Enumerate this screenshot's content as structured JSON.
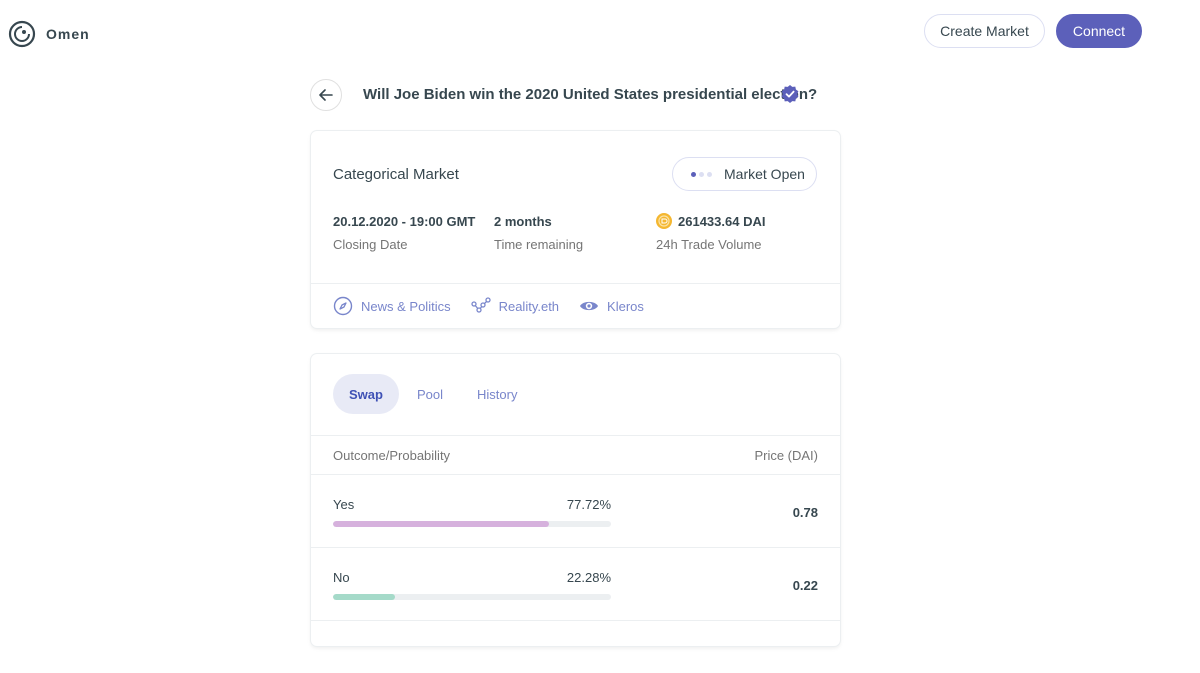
{
  "header": {
    "logo_text": "Omen",
    "create_market_label": "Create Market",
    "connect_label": "Connect"
  },
  "market": {
    "title": "Will Joe Biden win the 2020 United States presidential election?",
    "type": "Categorical Market",
    "status": "Market Open",
    "closing_date": {
      "value": "20.12.2020 - 19:00 GMT",
      "label": "Closing Date"
    },
    "time_remaining": {
      "value": "2 months",
      "label": "Time remaining"
    },
    "volume": {
      "value": "261433.64 DAI",
      "label": "24h Trade Volume"
    },
    "tags": [
      {
        "label": "News & Politics",
        "icon": "compass-icon"
      },
      {
        "label": "Reality.eth",
        "icon": "graph-icon"
      },
      {
        "label": "Kleros",
        "icon": "eye-icon"
      }
    ]
  },
  "trade": {
    "tabs": [
      {
        "label": "Swap",
        "active": true
      },
      {
        "label": "Pool",
        "active": false
      },
      {
        "label": "History",
        "active": false
      }
    ],
    "columns": {
      "outcome": "Outcome/Probability",
      "price": "Price (DAI)"
    },
    "outcomes": [
      {
        "name": "Yes",
        "probability": "77.72%",
        "probability_value": 0.7772,
        "price": "0.78",
        "color": "#d6b1dd"
      },
      {
        "name": "No",
        "probability": "22.28%",
        "probability_value": 0.2228,
        "price": "0.22",
        "color": "#a5dac9"
      }
    ]
  },
  "colors": {
    "accent": "#5c60ba",
    "tab_active_bg": "#e8eaf6",
    "link": "#7986cb"
  }
}
